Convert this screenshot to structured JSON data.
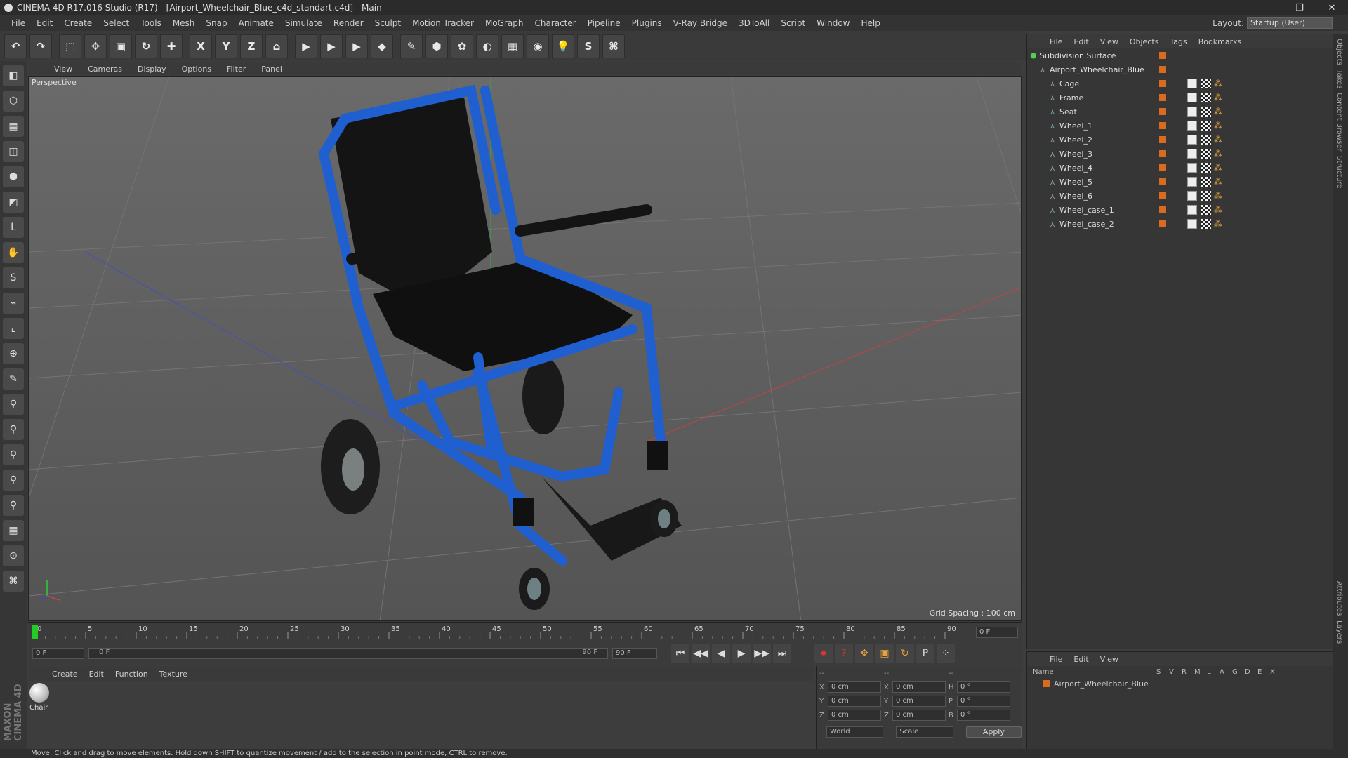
{
  "title": "CINEMA 4D R17.016 Studio (R17) - [Airport_Wheelchair_Blue_c4d_standart.c4d] - Main",
  "window_controls": [
    "–",
    "❐",
    "✕"
  ],
  "menu": [
    "File",
    "Edit",
    "Create",
    "Select",
    "Tools",
    "Mesh",
    "Snap",
    "Animate",
    "Simulate",
    "Render",
    "Sculpt",
    "Motion Tracker",
    "MoGraph",
    "Character",
    "Pipeline",
    "Plugins",
    "V-Ray Bridge",
    "3DToAll",
    "Script",
    "Window",
    "Help"
  ],
  "layout": {
    "label": "Layout:",
    "value": "Startup (User)"
  },
  "toolbar_glyphs": [
    "↶",
    "↷",
    "⬚",
    "✥",
    "▣",
    "↻",
    "✚",
    "X",
    "Y",
    "Z",
    "⌂",
    "▶",
    "▶",
    "▶",
    "◆",
    "✎",
    "⬢",
    "✿",
    "◐",
    "▦",
    "◉",
    "💡",
    "S",
    "⌘"
  ],
  "leftbar_glyphs": [
    "◧",
    "⬡",
    "▦",
    "◫",
    "⬢",
    "◩",
    "L",
    "✋",
    "S",
    "⌁",
    "⌞",
    "⊕",
    "✎",
    "⚲",
    "⚲",
    "⚲",
    "⚲",
    "⚲",
    "▦",
    "⊙",
    "⌘"
  ],
  "viewport": {
    "menu": [
      "View",
      "Cameras",
      "Display",
      "Options",
      "Filter",
      "Panel"
    ],
    "label": "Perspective",
    "grid_spacing": "Grid Spacing : 100 cm"
  },
  "timeline": {
    "ticks": [
      "0",
      "5",
      "10",
      "15",
      "20",
      "25",
      "30",
      "35",
      "40",
      "45",
      "50",
      "55",
      "60",
      "65",
      "70",
      "75",
      "80",
      "85",
      "90"
    ],
    "current_frame": "0 F",
    "start_field": "0 F",
    "range_start": "0 F",
    "range_end": "90 F",
    "end_field": "90 F"
  },
  "playback_glyphs": [
    "⏮",
    "◀◀",
    "◀",
    "▶",
    "▶▶",
    "⏭"
  ],
  "material_menu": [
    "Create",
    "Edit",
    "Function",
    "Texture"
  ],
  "materials": [
    {
      "name": "Chair"
    }
  ],
  "coords": {
    "header": [
      "--",
      "--",
      "--"
    ],
    "rows": [
      {
        "a": "X",
        "av": "0 cm",
        "b": "X",
        "bv": "0 cm",
        "c": "H",
        "cv": "0 °"
      },
      {
        "a": "Y",
        "av": "0 cm",
        "b": "Y",
        "bv": "0 cm",
        "c": "P",
        "cv": "0 °"
      },
      {
        "a": "Z",
        "av": "0 cm",
        "b": "Z",
        "bv": "0 cm",
        "c": "B",
        "cv": "0 °"
      }
    ],
    "world": "World",
    "scale": "Scale",
    "apply": "Apply"
  },
  "objects_menu": [
    "File",
    "Edit",
    "View",
    "Objects",
    "Tags",
    "Bookmarks"
  ],
  "objects": [
    {
      "name": "Subdivision Surface",
      "level": 0
    },
    {
      "name": "Airport_Wheelchair_Blue",
      "level": 1
    },
    {
      "name": "Cage",
      "level": 2
    },
    {
      "name": "Frame",
      "level": 2
    },
    {
      "name": "Seat",
      "level": 2
    },
    {
      "name": "Wheel_1",
      "level": 2
    },
    {
      "name": "Wheel_2",
      "level": 2
    },
    {
      "name": "Wheel_3",
      "level": 2
    },
    {
      "name": "Wheel_4",
      "level": 2
    },
    {
      "name": "Wheel_5",
      "level": 2
    },
    {
      "name": "Wheel_6",
      "level": 2
    },
    {
      "name": "Wheel_case_1",
      "level": 2
    },
    {
      "name": "Wheel_case_2",
      "level": 2
    }
  ],
  "layers_menu": [
    "File",
    "Edit",
    "View"
  ],
  "layers_cols": [
    "Name",
    "S",
    "V",
    "R",
    "M",
    "L",
    "A",
    "G",
    "D",
    "E",
    "X"
  ],
  "layers": [
    {
      "name": "Airport_Wheelchair_Blue"
    }
  ],
  "right_tabs": [
    "Objects",
    "Takes",
    "Content Browser",
    "Structure",
    "Attributes",
    "Layers"
  ],
  "maxon": "MAXON CINEMA 4D",
  "status": "Move: Click and drag to move elements. Hold down SHIFT to quantize movement / add to the selection in point mode, CTRL to remove.",
  "colors": {
    "accent": "#d86b1f",
    "frame_blue": "#1f5fd0",
    "viewport": "#5e5e5e"
  }
}
